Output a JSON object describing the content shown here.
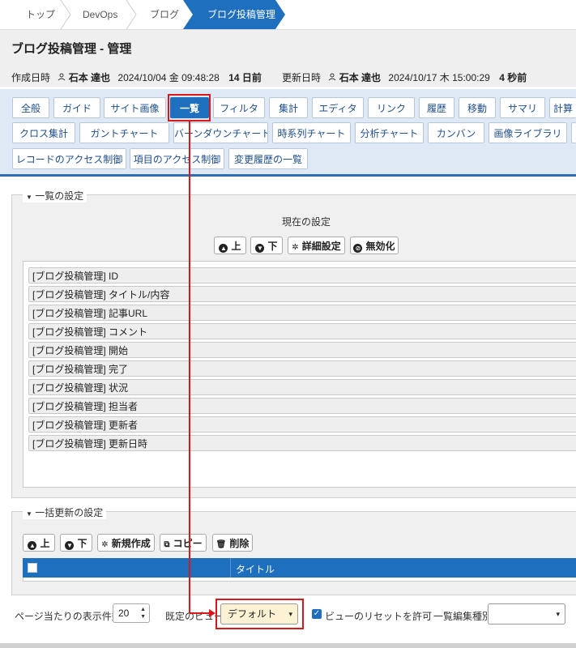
{
  "breadcrumb": {
    "items": [
      "トップ",
      "DevOps",
      "ブログ"
    ],
    "current": "ブログ投稿管理"
  },
  "header": {
    "title": "ブログ投稿管理 - 管理",
    "created_label": "作成日時",
    "created_user": "石本 達也",
    "created_datetime": "2024/10/04 金 09:48:28",
    "created_ago": "14 日前",
    "updated_label": "更新日時",
    "updated_user": "石本 達也",
    "updated_datetime": "2024/10/17 木 15:00:29",
    "updated_ago": "4 秒前"
  },
  "tabs": {
    "row1": [
      "全般",
      "ガイド",
      "サイト画像",
      "一覧",
      "フィルタ",
      "集計",
      "エディタ",
      "リンク",
      "履歴",
      "移動",
      "サマリ",
      "計算"
    ],
    "row2": [
      "クロス集計",
      "ガントチャート",
      "バーンダウンチャート",
      "時系列チャート",
      "分析チャート",
      "カンバン",
      "画像ライブラリ"
    ],
    "row3": [
      "レコードのアクセス制御",
      "項目のアクセス制御",
      "変更履歴の一覧"
    ],
    "active": "一覧"
  },
  "list_settings": {
    "legend": "一覧の設定",
    "current_label": "現在の設定",
    "buttons": {
      "up": "上",
      "down": "下",
      "detail": "詳細設定",
      "disable": "無効化"
    },
    "columns": [
      "[ブログ投稿管理] ID",
      "[ブログ投稿管理] タイトル/内容",
      "[ブログ投稿管理] 記事URL",
      "[ブログ投稿管理] コメント",
      "[ブログ投稿管理] 開始",
      "[ブログ投稿管理] 完了",
      "[ブログ投稿管理] 状況",
      "[ブログ投稿管理] 担当者",
      "[ブログ投稿管理] 更新者",
      "[ブログ投稿管理] 更新日時"
    ]
  },
  "bulk_settings": {
    "legend": "一括更新の設定",
    "buttons": {
      "up": "上",
      "down": "下",
      "new": "新規作成",
      "copy": "コピー",
      "delete": "削除"
    },
    "grid_header": {
      "title": "タイトル"
    }
  },
  "footer": {
    "page_size_label": "ページ当たりの表示件数",
    "page_size_value": "20",
    "default_view_label": "既定のビュー",
    "default_view_value": "デフォルト",
    "allow_reset_label": "ビューのリセットを許可",
    "allow_reset_checked": true,
    "edit_type_label": "一覧編集種別",
    "edit_type_value": ""
  },
  "colors": {
    "accent": "#1f6fbf",
    "highlight": "#d7191c",
    "tab_bg": "#dfe9f6"
  },
  "icons": [
    "user-icon",
    "circle-up-icon",
    "circle-down-icon",
    "gear-icon",
    "disable-icon",
    "copy-icon",
    "trash-icon",
    "checkbox-icon",
    "chevron-down-icon",
    "stepper-icon"
  ]
}
